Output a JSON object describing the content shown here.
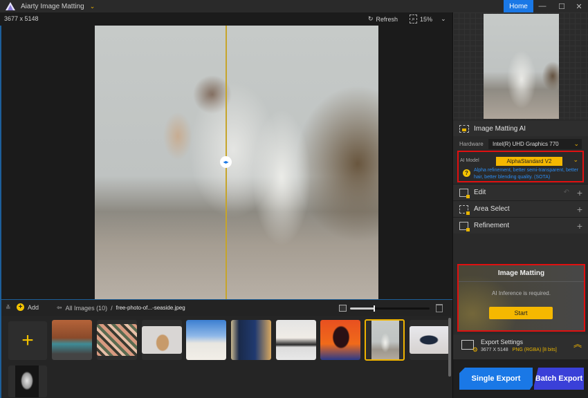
{
  "titlebar": {
    "app_title": "Aiarty Image Matting",
    "home_label": "Home",
    "minimize": "—",
    "maximize": "☐",
    "close": "✕",
    "chevron": "⌄"
  },
  "toolbar": {
    "dimensions": "3677 x 5148",
    "refresh_label": "Refresh",
    "refresh_icon": "↻",
    "zoom_value": "15%",
    "zoom_chevron": "⌄",
    "zoom_icon": "⌕"
  },
  "compare": {
    "handle_icon": "◂▸"
  },
  "filebar": {
    "collapse_icon": "≚",
    "add_label": "Add",
    "add_icon": "+",
    "back_icon": "⇦",
    "all_images": "All Images (10)",
    "separator": "/",
    "current_file": "free-photo-of...-seaside.jpeg",
    "thumb_size_fraction": 0.3
  },
  "strip": {
    "add_tile_icon": "+",
    "thumbnails": [
      {
        "name": "car",
        "selected": false
      },
      {
        "name": "flowers",
        "selected": false
      },
      {
        "name": "woman-portrait",
        "selected": false
      },
      {
        "name": "skateboarder",
        "selected": false
      },
      {
        "name": "woman-blue-dress",
        "selected": false
      },
      {
        "name": "sofa",
        "selected": false
      },
      {
        "name": "silhouette",
        "selected": false
      },
      {
        "name": "bride-seaside",
        "selected": true
      },
      {
        "name": "group-jumping",
        "selected": false
      },
      {
        "name": "dove-statue",
        "selected": false
      }
    ]
  },
  "panel": {
    "section_title": "Image Matting AI",
    "hardware_label": "Hardware",
    "hardware_value": "Intel(R) UHD Graphics 770",
    "ai_model_label": "AI Model",
    "ai_model_value": "AlphaStandard  V2",
    "ai_model_desc": "Alpha refinement, better semi-transparent, better hair, better blending quality. (SOTA)",
    "help_icon": "?",
    "chevron": "⌄",
    "tools": [
      {
        "label": "Edit",
        "icon": "crop-edit-icon"
      },
      {
        "label": "Area Select",
        "icon": "area-select-icon"
      },
      {
        "label": "Refinement",
        "icon": "refinement-icon"
      }
    ],
    "plus": "+",
    "undo": "↶",
    "matting": {
      "title": "Image Matting",
      "message": "AI Inference is required.",
      "start_label": "Start"
    },
    "export": {
      "title": "Export Settings",
      "dims": "3677 X 5148",
      "format": "PNG (RGBA) [8 bits]",
      "collapse_icon": "︽"
    },
    "single_export": "Single Export",
    "batch_export": "Batch Export"
  },
  "colors": {
    "accent": "#1a78e6",
    "highlight": "#f5b800",
    "alert_border": "#e01010",
    "batch": "#3a40d8"
  }
}
